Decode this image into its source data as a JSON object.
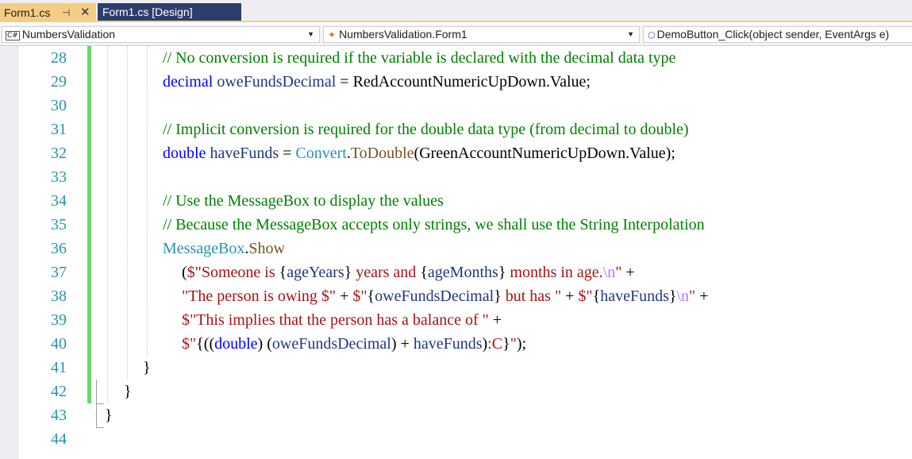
{
  "tabs": {
    "active_label": "Form1.cs",
    "pin_glyph": "⊣",
    "close_glyph": "✕",
    "inactive_label": "Form1.cs [Design]"
  },
  "nav": {
    "project": "NumbersValidation",
    "project_icon": "C#",
    "class": "NumbersValidation.Form1",
    "member": "DemoButton_Click(object sender, EventArgs e)"
  },
  "lines": {
    "l28": {
      "num": "28",
      "comment": "// No conversion is required if the variable is declared with the decimal data type"
    },
    "l29": {
      "num": "29",
      "kw": "decimal",
      "var": " oweFundsDecimal",
      "rest": " = RedAccountNumericUpDown.Value;"
    },
    "l30": {
      "num": "30"
    },
    "l31": {
      "num": "31",
      "comment": "// Implicit conversion is required for the double data type (from decimal to double)"
    },
    "l32": {
      "num": "32",
      "kw": "double",
      "var": " haveFunds",
      "eq": " = ",
      "type": "Convert",
      "dot": ".",
      "method": "ToDouble",
      "rest": "(GreenAccountNumericUpDown.Value);"
    },
    "l33": {
      "num": "33"
    },
    "l34": {
      "num": "34",
      "comment": "// Use the MessageBox to display the values"
    },
    "l35": {
      "num": "35",
      "comment": "// Because the MessageBox accepts only strings, we shall use the String Interpolation"
    },
    "l36": {
      "num": "36",
      "type": "MessageBox",
      "dot": ".",
      "method": "Show"
    },
    "l37": {
      "num": "37",
      "p1": "(",
      "s1": "$\"Someone is ",
      "b1": "{",
      "v1": "ageYears",
      "b2": "}",
      "s2": " years and ",
      "b3": "{",
      "v2": "ageMonths",
      "b4": "}",
      "s3": " months in age.",
      "esc": "\\n",
      "s4": "\"",
      "tail": " +"
    },
    "l38": {
      "num": "38",
      "s1": "\"The person is owing $\"",
      "op1": " + ",
      "s2": "$\"",
      "b1": "{",
      "v1": "oweFundsDecimal",
      "b2": "}",
      "s3": " but has \"",
      "op2": " + ",
      "s4": "$\"",
      "b3": "{",
      "v2": "haveFunds",
      "b4": "}",
      "esc": "\\n",
      "s5": "\"",
      "tail": " +"
    },
    "l39": {
      "num": "39",
      "s1": "$\"This implies that the person has a balance of \"",
      "tail": " +"
    },
    "l40": {
      "num": "40",
      "s1": "$\"",
      "b1": "{",
      "p1": "((",
      "kw": "double",
      "p2": ") ",
      "p3": "(",
      "v1": "oweFundsDecimal",
      "p4": ")",
      "op": " + ",
      "v2": "haveFunds",
      "p5": ")",
      "colon": ":",
      "fmt": "C",
      "b2": "}",
      "s2": "\"",
      "tail": ");"
    },
    "l41": {
      "num": "41",
      "brace": "}"
    },
    "l42": {
      "num": "42",
      "brace": "}"
    },
    "l43": {
      "num": "43",
      "brace": "}"
    },
    "l44": {
      "num": "44"
    }
  },
  "colors": {
    "keyword": "#0000ff",
    "comment": "#008000",
    "type": "#2b91af",
    "method": "#74531f",
    "string": "#a31515",
    "escape": "#b776fb",
    "variable": "#1f377f",
    "line_number": "#2b91af",
    "change_bar": "#6bd66b",
    "active_tab": "#f5cc84",
    "inactive_tab": "#2d3e6e"
  }
}
